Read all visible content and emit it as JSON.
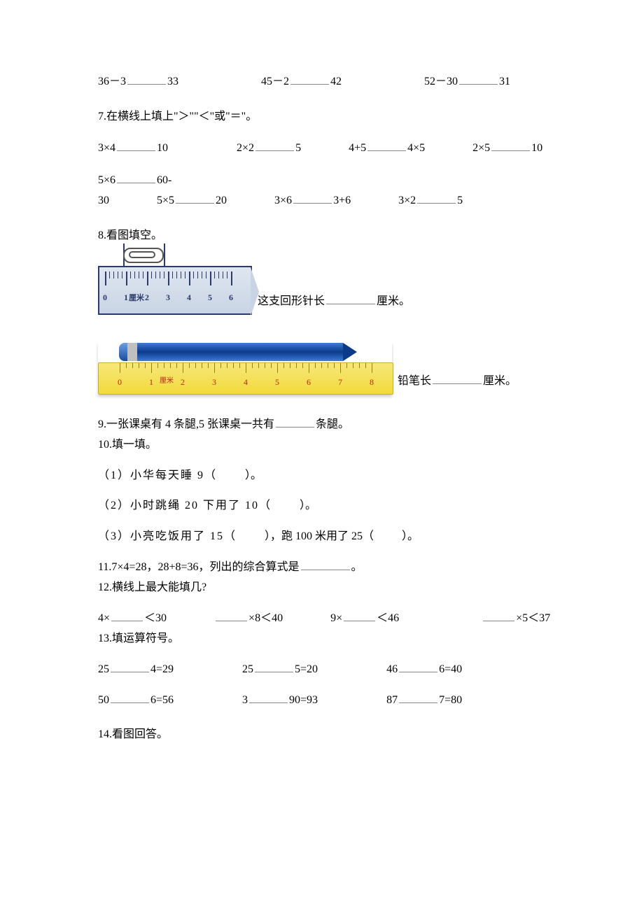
{
  "q6": {
    "items": [
      {
        "l": "36－3",
        "r": "33"
      },
      {
        "l": "45－2",
        "r": "42"
      },
      {
        "l": "52－30",
        "r": "31"
      }
    ]
  },
  "q7": {
    "title": "7.在横线上填上\"＞\"\"＜\"或\"＝\"。",
    "row1": [
      {
        "l": "3×4",
        "r": "10"
      },
      {
        "l": "2×2",
        "r": "5"
      },
      {
        "l": "4+5",
        "r": "4×5"
      },
      {
        "l": "2×5",
        "r": "10"
      }
    ],
    "row2_lead_l": "5×6",
    "row2_lead_r": "60-",
    "row2_cont": "30",
    "row2_rest": [
      {
        "l": "5×5",
        "r": "20"
      },
      {
        "l": "3×6",
        "r": "3+6"
      },
      {
        "l": "3×2",
        "r": "5"
      }
    ]
  },
  "q8": {
    "title": "8.看图填空。",
    "clip_caption_1": "这支回形针长",
    "clip_caption_2": "厘米。",
    "pencil_caption_1": "铅笔长",
    "pencil_caption_2": "厘米。",
    "ruler1_nums": [
      "0",
      "1",
      "2",
      "3",
      "4",
      "5",
      "6"
    ],
    "ruler1_unit": "厘米",
    "ruler2_nums": [
      "0",
      "1",
      "2",
      "3",
      "4",
      "5",
      "6",
      "7",
      "8"
    ],
    "ruler2_unit": "厘米"
  },
  "q9": "9.一张课桌有 4 条腿,5 张课桌一共有",
  "q9_tail": "条腿。",
  "q10": {
    "title": "10.填一填。",
    "i1_a": "（1）小华每天睡 9（",
    "i1_b": "）。",
    "i2_a": "（2）小时跳绳 20 下用了 10（",
    "i2_b": "）。",
    "i3_a": "（3）小亮吃饭用了 15（",
    "i3_b": "），跑 100 米用了 25（",
    "i3_c": "）。"
  },
  "q11_a": "11.7×4=28，28+8=36，列出的综合算式是",
  "q11_b": "。",
  "q12": {
    "title": "12.横线上最大能填几?",
    "items": [
      {
        "pre": "4×",
        "post": "＜30"
      },
      {
        "pre": "",
        "post": "×8＜40"
      },
      {
        "pre": "9×",
        "post": "＜46"
      },
      {
        "pre": "",
        "post": "×5＜37"
      }
    ]
  },
  "q13": {
    "title": "13.填运算符号。",
    "row1": [
      {
        "l": "25",
        "r": "4=29"
      },
      {
        "l": "25",
        "r": "5=20"
      },
      {
        "l": "46",
        "r": "6=40"
      }
    ],
    "row2": [
      {
        "l": "50",
        "r": "6=56"
      },
      {
        "l": "3",
        "r": "90=93"
      },
      {
        "l": "87",
        "r": "7=80"
      }
    ]
  },
  "q14": "14.看图回答。"
}
